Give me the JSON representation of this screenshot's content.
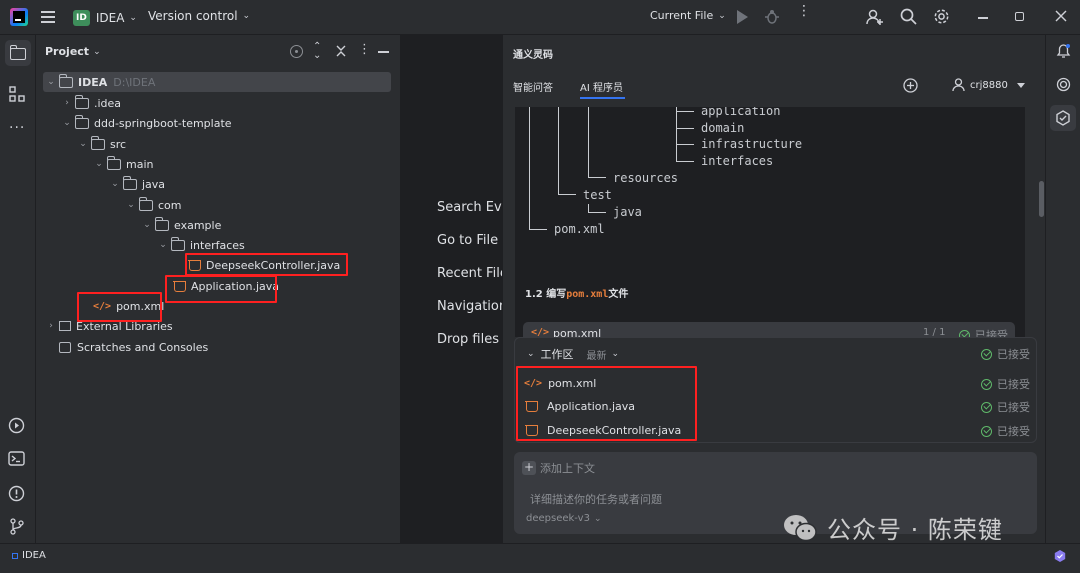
{
  "titlebar": {
    "project_badge": "ID",
    "project_name": "IDEA",
    "vcs_label": "Version control",
    "run_config": "Current File"
  },
  "project_panel": {
    "title": "Project",
    "tree": [
      {
        "label": "IDEA",
        "path": "D:\\IDEA",
        "kind": "folder",
        "depth": 0,
        "expanded": true
      },
      {
        "label": ".idea",
        "kind": "folder",
        "depth": 1,
        "expanded": false
      },
      {
        "label": "ddd-springboot-template",
        "kind": "folder",
        "depth": 1,
        "expanded": true
      },
      {
        "label": "src",
        "kind": "folder",
        "depth": 2,
        "expanded": true
      },
      {
        "label": "main",
        "kind": "folder",
        "depth": 3,
        "expanded": true
      },
      {
        "label": "java",
        "kind": "folder",
        "depth": 4,
        "expanded": true
      },
      {
        "label": "com",
        "kind": "folder",
        "depth": 5,
        "expanded": true
      },
      {
        "label": "example",
        "kind": "folder",
        "depth": 6,
        "expanded": true
      },
      {
        "label": "interfaces",
        "kind": "folder",
        "depth": 7,
        "expanded": true
      },
      {
        "label": "DeepseekController.java",
        "kind": "java",
        "depth": 8
      },
      {
        "label": "Application.java",
        "kind": "java",
        "depth": 7
      },
      {
        "label": "pom.xml",
        "kind": "xml",
        "depth": 2
      },
      {
        "label": "External Libraries",
        "kind": "lib",
        "depth": 0,
        "expanded": false
      },
      {
        "label": "Scratches and Consoles",
        "kind": "scratch",
        "depth": 0
      }
    ]
  },
  "editor_hints": {
    "search": "Search Eve",
    "goto": "Go to File",
    "recent": "Recent File",
    "nav": "Navigation",
    "drop": "Drop files"
  },
  "ai_panel": {
    "title": "通义灵码",
    "tabs": [
      "智能问答",
      "AI 程序员"
    ],
    "user": "crj8880",
    "code_tree": {
      "application": "application",
      "domain": "domain",
      "infrastructure": "infrastructure",
      "interfaces": "interfaces",
      "resources": "resources",
      "test": "test",
      "java": "java",
      "pom": "pom.xml"
    },
    "section_heading_prefix": "1.2 编写",
    "section_heading_code": "pom.xml",
    "section_heading_suffix": "文件",
    "file_card": {
      "name": "pom.xml",
      "pager": "1 / 1",
      "status": "已接受"
    },
    "workspace": {
      "title": "工作区",
      "sort": "最新",
      "status": "已接受",
      "files": [
        {
          "name": "pom.xml",
          "icon": "xml",
          "status": "已接受"
        },
        {
          "name": "Application.java",
          "icon": "java",
          "status": "已接受"
        },
        {
          "name": "DeepseekController.java",
          "icon": "java",
          "status": "已接受"
        }
      ]
    },
    "input": {
      "add_context": "添加上下文",
      "placeholder": "详细描述你的任务或者问题",
      "model": "deepseek-v3"
    }
  },
  "watermark": {
    "text": "公众号 · 陈荣键"
  },
  "statusbar": {
    "project": "IDEA"
  },
  "colors": {
    "accent_red": "#ff2020",
    "java_orange": "#e67e3c",
    "accepted_green": "#5fb86a",
    "badge_green": "#3e8e5b"
  }
}
